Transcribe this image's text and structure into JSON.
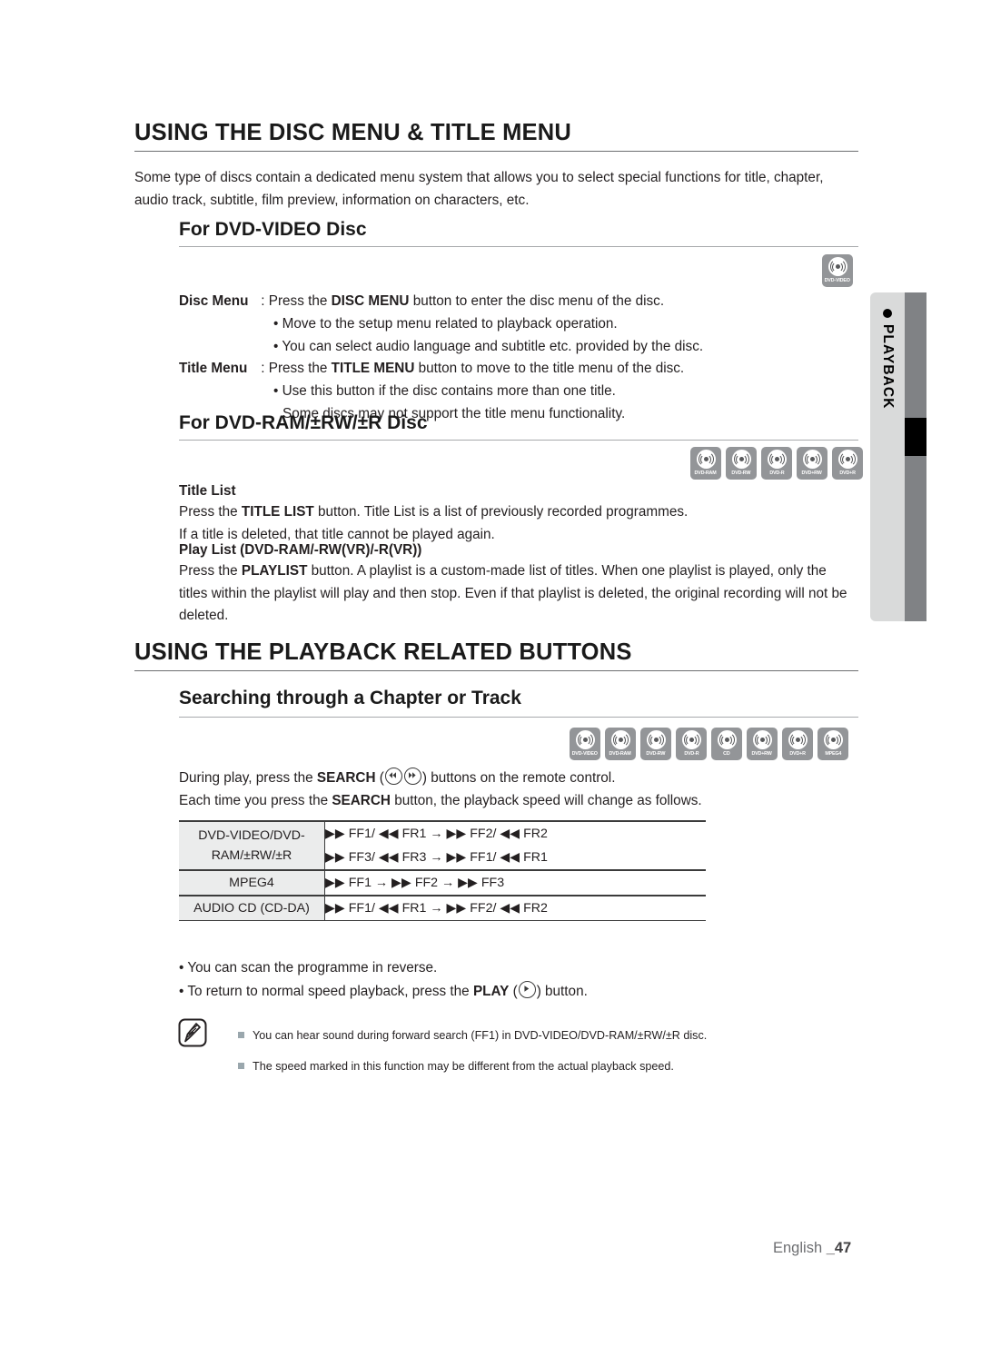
{
  "side_tab": {
    "label": "PLAYBACK",
    "bullet": "●",
    "light_color": "#d9dada",
    "dark_color": "#808285",
    "marker_color": "#000000"
  },
  "section1": {
    "title": "USING THE DISC MENU & TITLE MENU",
    "intro_line1": "Some type of discs contain a dedicated menu system that allows you to select special functions for title, chapter,",
    "intro_line2": "audio track, subtitle, film preview, information on characters, etc.",
    "sub1": {
      "heading": "For DVD-VIDEO Disc",
      "discs": [
        "DVD-VIDEO"
      ],
      "disc_menu_term": "Disc Menu",
      "disc_menu_sep": " : Press the ",
      "disc_menu_bold": "DISC MENU",
      "disc_menu_rest": " button to enter the disc menu of the disc.",
      "disc_menu_b1": "• Move to the setup menu related to playback operation.",
      "disc_menu_b2": "• You can select audio language and subtitle etc. provided by the disc.",
      "title_menu_term": "Title Menu",
      "title_menu_sep": " : Press the ",
      "title_menu_bold": "TITLE MENU",
      "title_menu_rest": " button to move to the title menu of the disc.",
      "title_menu_b1": "• Use this button if the disc contains more than one title.",
      "title_menu_b2": "Some discs may not support the title menu functionality."
    },
    "sub2": {
      "heading": "For DVD-RAM/±RW/±R Disc",
      "discs": [
        "DVD-RAM",
        "DVD-RW",
        "DVD-R",
        "DVD+RW",
        "DVD+R"
      ],
      "title_list_head": "Title List",
      "title_list_l1_a": "Press the ",
      "title_list_l1_b": "TITLE LIST",
      "title_list_l1_c": " button. Title List is a list of previously recorded programmes.",
      "title_list_l2": "If a title is deleted, that title cannot be played again.",
      "play_list_head": "Play List (DVD-RAM/-RW(VR)/-R(VR))",
      "play_list_l1_a": "Press the ",
      "play_list_l1_b": "PLAYLIST",
      "play_list_l1_c": " button. A playlist is a custom-made list of titles. When one playlist is played, only the",
      "play_list_l2": "titles within the playlist will play and then stop. Even if that playlist is deleted, the original recording will not be",
      "play_list_l3": "deleted."
    }
  },
  "section2": {
    "title": "USING THE PLAYBACK RELATED BUTTONS",
    "sub1": {
      "heading": "Searching through a Chapter or Track",
      "discs": [
        "DVD-VIDEO",
        "DVD-RAM",
        "DVD-RW",
        "DVD-R",
        "CD",
        "DVD+RW",
        "DVD+R",
        "MPEG4"
      ],
      "intro_l1_a": "During play, press the ",
      "intro_l1_b": "SEARCH",
      "intro_l1_c": " (",
      "intro_l1_d": ") buttons on the remote control.",
      "intro_l2_a": "Each time you press the ",
      "intro_l2_b": "SEARCH",
      "intro_l2_c": " button, the playback speed will change as follows.",
      "table": {
        "rows": [
          {
            "disc": "DVD-VIDEO/DVD-RAM/±RW/±R",
            "disc_line1": "DVD-VIDEO/DVD-",
            "disc_line2": "RAM/±RW/±R",
            "sequences": [
              "▶▶ FF1/ ◀◀ FR1 → ▶▶ FF2/ ◀◀ FR2",
              "▶▶ FF3/ ◀◀ FR3 → ▶▶ FF1/ ◀◀ FR1"
            ]
          },
          {
            "disc": "MPEG4",
            "disc_line1": "MPEG4",
            "disc_line2": "",
            "sequences": [
              "▶▶ FF1 → ▶▶ FF2 → ▶▶ FF3"
            ]
          },
          {
            "disc": "AUDIO CD (CD-DA)",
            "disc_line1": "AUDIO CD (CD-DA)",
            "disc_line2": "",
            "sequences": [
              "▶▶ FF1/ ◀◀ FR1 → ▶▶ FF2/ ◀◀ FR2"
            ]
          }
        ]
      },
      "bullet1": "• You can scan the programme in reverse.",
      "bullet2_a": "• To return to normal speed playback, press the ",
      "bullet2_b": "PLAY",
      "bullet2_c": " (",
      "bullet2_d": ") button.",
      "notes": [
        "You can hear sound during forward search (FF1) in DVD-VIDEO/DVD-RAM/±RW/±R disc.",
        "The speed marked in this function may be different from the actual playback speed."
      ]
    }
  },
  "footer": {
    "language": "English ",
    "page": "_47"
  }
}
